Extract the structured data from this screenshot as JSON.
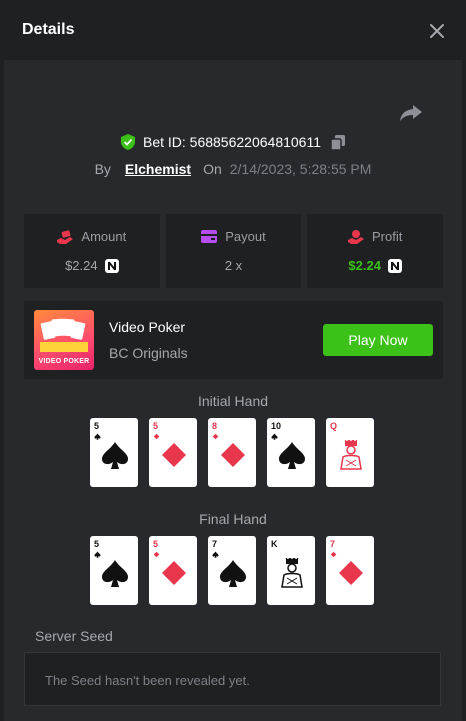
{
  "header": {
    "title": "Details",
    "close_icon": "close-icon"
  },
  "bet": {
    "id_label": "Bet ID: 56885622064810611",
    "by_label": "By",
    "user": "Elchemist",
    "on_label": "On",
    "date": "2/14/2023, 5:28:55 PM"
  },
  "stats": {
    "amount": {
      "label": "Amount",
      "value": "$2.24",
      "icon": "wallet-hand-icon",
      "color": "#e8364c"
    },
    "payout": {
      "label": "Payout",
      "value": "2 x",
      "icon": "card-wallet-icon",
      "color": "#b74cf0"
    },
    "profit": {
      "label": "Profit",
      "value": "$2.24",
      "icon": "money-hand-icon",
      "color": "#e8364c"
    }
  },
  "game": {
    "name": "Video Poker",
    "provider": "BC Originals",
    "thumb_text": "VIDEO POKER",
    "play_label": "Play Now"
  },
  "initial_hand": {
    "label": "Initial Hand",
    "cards": [
      {
        "rank": "5",
        "suit": "spades"
      },
      {
        "rank": "5",
        "suit": "diamonds"
      },
      {
        "rank": "8",
        "suit": "diamonds"
      },
      {
        "rank": "10",
        "suit": "spades"
      },
      {
        "rank": "Q",
        "suit": "diamonds"
      }
    ]
  },
  "final_hand": {
    "label": "Final Hand",
    "cards": [
      {
        "rank": "5",
        "suit": "spades"
      },
      {
        "rank": "5",
        "suit": "diamonds"
      },
      {
        "rank": "7",
        "suit": "spades"
      },
      {
        "rank": "K",
        "suit": "clubs"
      },
      {
        "rank": "7",
        "suit": "diamonds"
      }
    ]
  },
  "server_seed": {
    "label": "Server Seed",
    "placeholder": "The Seed hasn't been revealed yet."
  },
  "colors": {
    "accent_green": "#3bc117",
    "red": "#e8364c",
    "panel": "#27292c",
    "bg": "#1e2022"
  }
}
